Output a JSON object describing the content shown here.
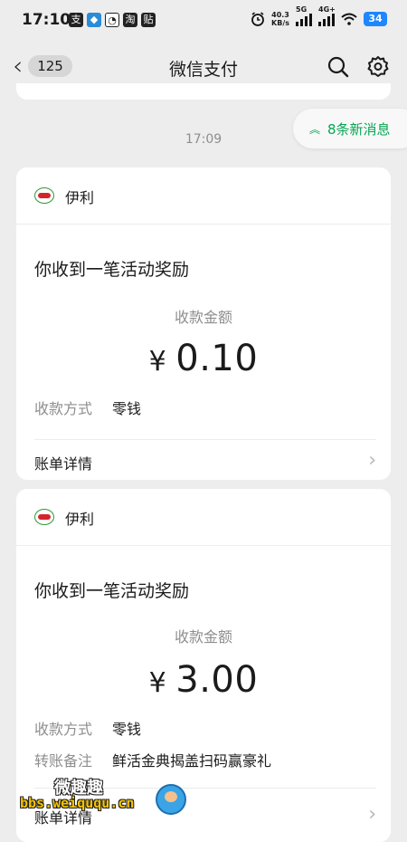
{
  "status_bar": {
    "time": "17:10",
    "apps": [
      "支",
      "◆",
      "◔",
      "淘",
      "贴"
    ],
    "network_speed": "40.3",
    "network_unit": "KB/s",
    "net_5g": "5G",
    "net_4g": "4G+",
    "battery": "34"
  },
  "nav": {
    "unread_count": "125",
    "title": "微信支付"
  },
  "new_messages": {
    "label": "8条新消息"
  },
  "chat": {
    "time_separator": "17:09"
  },
  "cards": [
    {
      "brand": "伊利",
      "headline": "你收到一笔活动奖励",
      "amount_label": "收款金额",
      "currency": "¥",
      "amount": "0.10",
      "rows": [
        {
          "label": "收款方式",
          "value": "零钱"
        }
      ],
      "detail_label": "账单详情"
    },
    {
      "brand": "伊利",
      "headline": "你收到一笔活动奖励",
      "amount_label": "收款金额",
      "currency": "¥",
      "amount": "3.00",
      "rows": [
        {
          "label": "收款方式",
          "value": "零钱"
        },
        {
          "label": "转账备注",
          "value": "鲜活金典揭盖扫码赢豪礼"
        }
      ],
      "detail_label": "账单详情"
    }
  ],
  "watermark": {
    "title": "微趣趣",
    "url": "bbs.weiququ.cn"
  },
  "colors": {
    "background": "#ededed",
    "accent_green": "#07a553",
    "battery_blue": "#1e86ff"
  }
}
